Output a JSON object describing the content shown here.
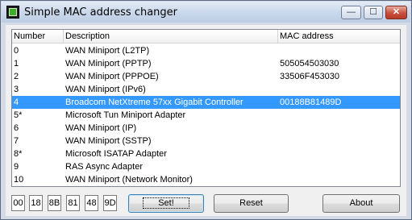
{
  "window": {
    "title": "Simple MAC address changer",
    "min_glyph": "—",
    "max_glyph": "☐",
    "close_glyph": "✕"
  },
  "table": {
    "columns": [
      "Number",
      "Description",
      "MAC address"
    ],
    "rows": [
      {
        "number": "0",
        "description": "WAN Miniport (L2TP)",
        "mac": ""
      },
      {
        "number": "1",
        "description": "WAN Miniport (PPTP)",
        "mac": "505054503030"
      },
      {
        "number": "2",
        "description": "WAN Miniport (PPPOE)",
        "mac": "33506F453030"
      },
      {
        "number": "3",
        "description": "WAN Miniport (IPv6)",
        "mac": ""
      },
      {
        "number": "4",
        "description": "Broadcom NetXtreme 57xx Gigabit Controller",
        "mac": "00188B81489D"
      },
      {
        "number": "5*",
        "description": "Microsoft Tun Miniport Adapter",
        "mac": ""
      },
      {
        "number": "6",
        "description": "WAN Miniport (IP)",
        "mac": ""
      },
      {
        "number": "7",
        "description": "WAN Miniport (SSTP)",
        "mac": ""
      },
      {
        "number": "8*",
        "description": "Microsoft ISATAP Adapter",
        "mac": ""
      },
      {
        "number": "9",
        "description": "RAS Async Adapter",
        "mac": ""
      },
      {
        "number": "10",
        "description": "WAN Miniport (Network Monitor)",
        "mac": ""
      }
    ],
    "selected_row": 4
  },
  "mac_bytes": [
    "00",
    "18",
    "8B",
    "81",
    "48",
    "9D"
  ],
  "buttons": {
    "set": "Set!",
    "reset": "Reset",
    "about": "About"
  },
  "colors": {
    "selection": "#3399ff",
    "title_bg": "#c9d7ea",
    "close_button": "#c8503d"
  }
}
